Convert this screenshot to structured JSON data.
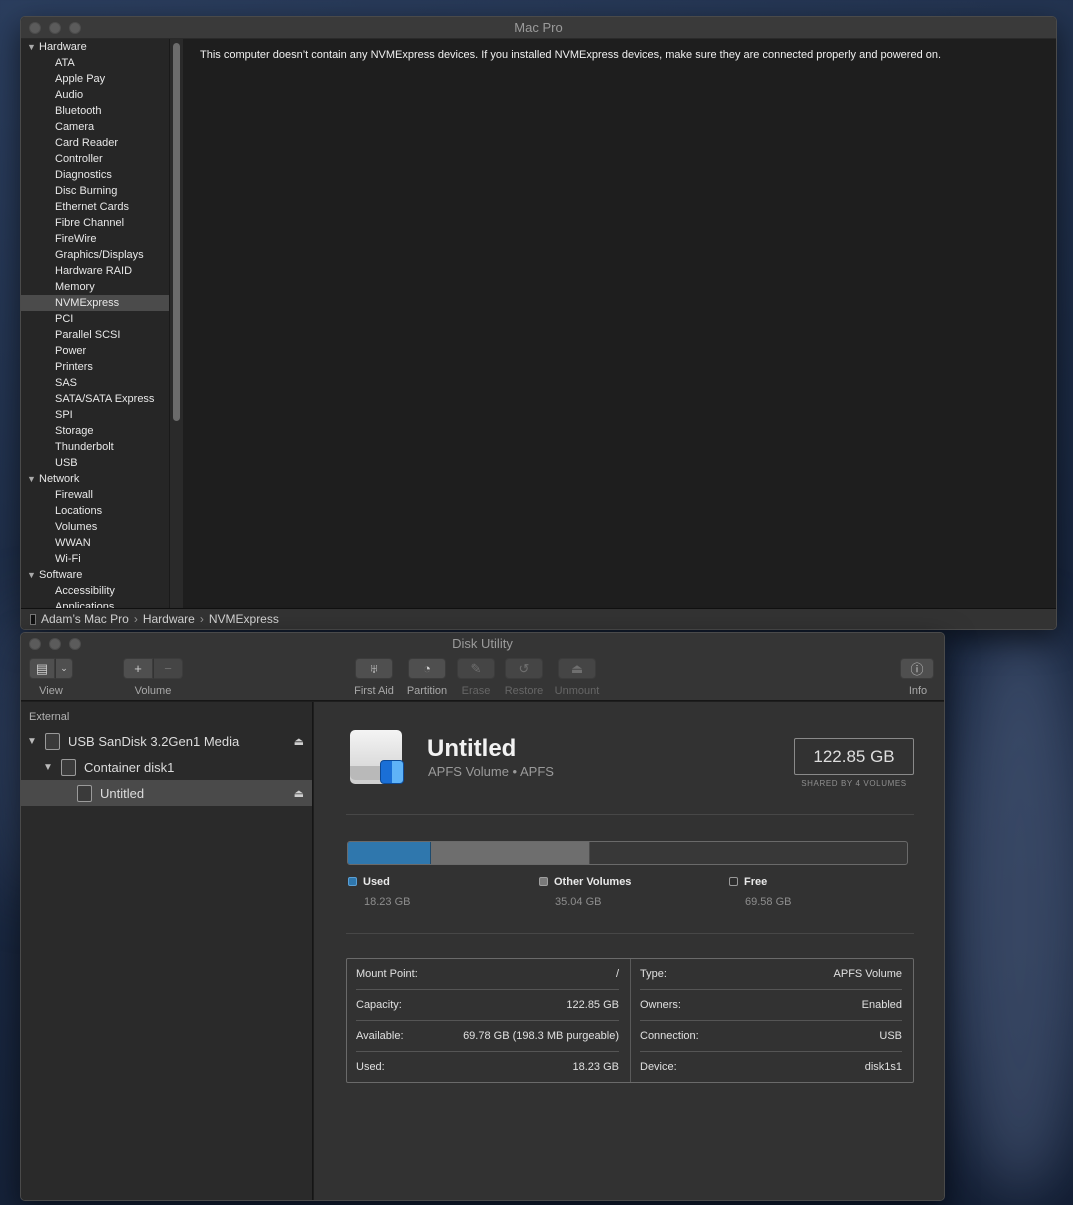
{
  "system_info": {
    "window_title": "Mac Pro",
    "sidebar": [
      {
        "type": "group",
        "label": "Hardware"
      },
      {
        "type": "item",
        "label": "ATA"
      },
      {
        "type": "item",
        "label": "Apple Pay"
      },
      {
        "type": "item",
        "label": "Audio"
      },
      {
        "type": "item",
        "label": "Bluetooth"
      },
      {
        "type": "item",
        "label": "Camera"
      },
      {
        "type": "item",
        "label": "Card Reader"
      },
      {
        "type": "item",
        "label": "Controller"
      },
      {
        "type": "item",
        "label": "Diagnostics"
      },
      {
        "type": "item",
        "label": "Disc Burning"
      },
      {
        "type": "item",
        "label": "Ethernet Cards"
      },
      {
        "type": "item",
        "label": "Fibre Channel"
      },
      {
        "type": "item",
        "label": "FireWire"
      },
      {
        "type": "item",
        "label": "Graphics/Displays"
      },
      {
        "type": "item",
        "label": "Hardware RAID"
      },
      {
        "type": "item",
        "label": "Memory"
      },
      {
        "type": "item",
        "label": "NVMExpress",
        "selected": true
      },
      {
        "type": "item",
        "label": "PCI"
      },
      {
        "type": "item",
        "label": "Parallel SCSI"
      },
      {
        "type": "item",
        "label": "Power"
      },
      {
        "type": "item",
        "label": "Printers"
      },
      {
        "type": "item",
        "label": "SAS"
      },
      {
        "type": "item",
        "label": "SATA/SATA Express"
      },
      {
        "type": "item",
        "label": "SPI"
      },
      {
        "type": "item",
        "label": "Storage"
      },
      {
        "type": "item",
        "label": "Thunderbolt"
      },
      {
        "type": "item",
        "label": "USB"
      },
      {
        "type": "group",
        "label": "Network"
      },
      {
        "type": "item",
        "label": "Firewall"
      },
      {
        "type": "item",
        "label": "Locations"
      },
      {
        "type": "item",
        "label": "Volumes"
      },
      {
        "type": "item",
        "label": "WWAN"
      },
      {
        "type": "item",
        "label": "Wi-Fi"
      },
      {
        "type": "group",
        "label": "Software"
      },
      {
        "type": "item",
        "label": "Accessibility"
      },
      {
        "type": "item",
        "label": "Applications"
      }
    ],
    "message": "This computer doesn’t contain any NVMExpress devices. If you installed NVMExpress devices, make sure they are connected properly and powered on.",
    "path": [
      "Adam’s Mac Pro",
      "Hardware",
      "NVMExpress"
    ]
  },
  "disk_utility": {
    "window_title": "Disk Utility",
    "toolbar": {
      "view_label": "View",
      "volume_label": "Volume",
      "first_aid_label": "First Aid",
      "partition_label": "Partition",
      "erase_label": "Erase",
      "restore_label": "Restore",
      "unmount_label": "Unmount",
      "info_label": "Info"
    },
    "sidebar": {
      "section": "External",
      "drive": "USB SanDisk 3.2Gen1 Media",
      "container": "Container disk1",
      "volume": "Untitled"
    },
    "volume": {
      "name": "Untitled",
      "subtitle": "APFS Volume • APFS",
      "capacity": "122.85 GB",
      "shared": "SHARED BY 4 VOLUMES"
    },
    "usage": {
      "total_gb": 122.85,
      "used": {
        "label": "Used",
        "value": "18.23 GB",
        "gb": 18.23,
        "color": "#2f77ad"
      },
      "other": {
        "label": "Other Volumes",
        "value": "35.04 GB",
        "gb": 35.04,
        "color": "#7a7a7a"
      },
      "free": {
        "label": "Free",
        "value": "69.58 GB",
        "gb": 69.58,
        "color": "#3a3a3a"
      }
    },
    "info": {
      "left": [
        {
          "k": "Mount Point:",
          "v": "/"
        },
        {
          "k": "Capacity:",
          "v": "122.85 GB"
        },
        {
          "k": "Available:",
          "v": "69.78 GB (198.3 MB purgeable)"
        },
        {
          "k": "Used:",
          "v": "18.23 GB"
        }
      ],
      "right": [
        {
          "k": "Type:",
          "v": "APFS Volume"
        },
        {
          "k": "Owners:",
          "v": "Enabled"
        },
        {
          "k": "Connection:",
          "v": "USB"
        },
        {
          "k": "Device:",
          "v": "disk1s1"
        }
      ]
    }
  }
}
